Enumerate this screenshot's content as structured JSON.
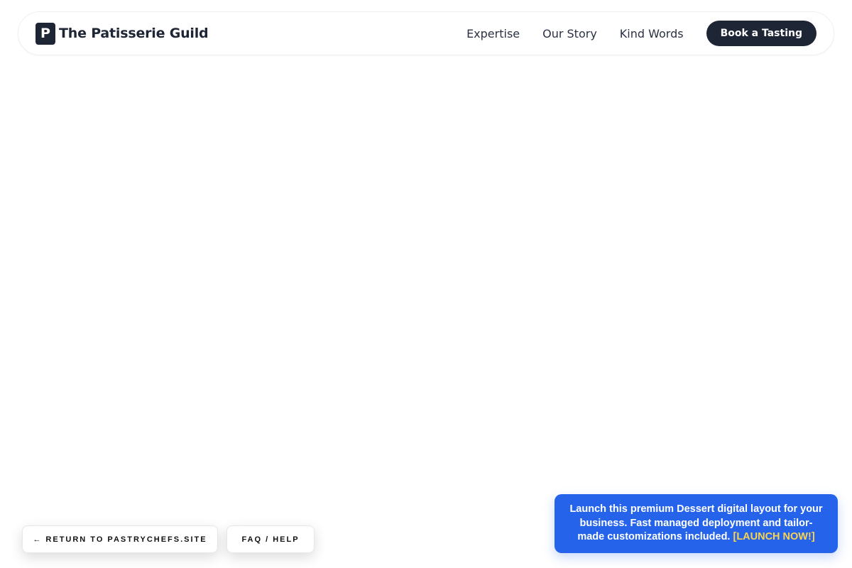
{
  "header": {
    "logo_letter": "P",
    "brand_name": "The Patisserie Guild",
    "nav": [
      {
        "label": "Expertise"
      },
      {
        "label": "Our Story"
      },
      {
        "label": "Kind Words"
      }
    ],
    "cta_label": "Book a Tasting"
  },
  "footer_actions": {
    "return_label": "← RETURN TO PASTRYCHEFS.SITE",
    "faq_label": "FAQ / HELP"
  },
  "promo": {
    "text": "Launch this premium Dessert digital layout for your business. Fast managed deployment and tailor-made customizations included.",
    "link_label": "[LAUNCH NOW!]"
  },
  "colors": {
    "brand_dark": "#1e2535",
    "promo_blue": "#2563eb",
    "promo_link": "#fcd34d"
  }
}
